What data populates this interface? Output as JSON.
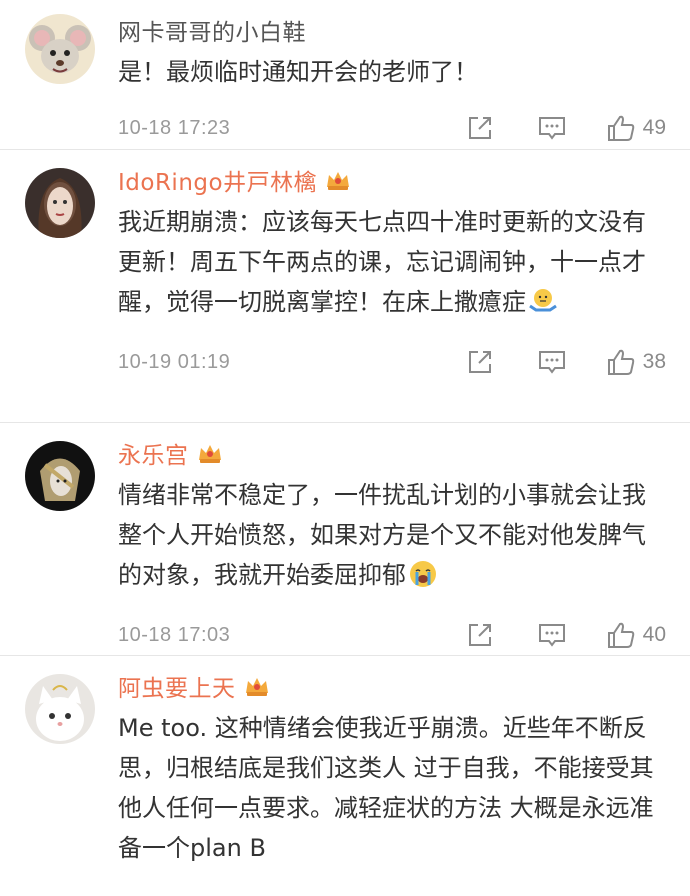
{
  "comments": [
    {
      "username": "网卡哥哥的小白鞋",
      "text": "是！最烦临时通知开会的老师了！",
      "time": "10-18 17:23",
      "likes": "49"
    },
    {
      "username": "IdoRingo井戸林檎",
      "text": "我近期崩溃：应该每天七点四十准时更新的文没有更新！周五下午两点的课，忘记调闹钟，十一点才醒，觉得一切脱离掌控！在床上撒癔症",
      "time": "10-19 01:19",
      "likes": "38"
    },
    {
      "username": "永乐宫",
      "text": "情绪非常不稳定了，一件扰乱计划的小事就会让我整个人开始愤怒，如果对方是个又不能对他发脾气的对象，我就开始委屈抑郁",
      "time": "10-18 17:03",
      "likes": "40"
    },
    {
      "username": "阿虫要上天",
      "text": "Me too. 这种情绪会使我近乎崩溃。近些年不断反思，归根结底是我们这类人 过于自我，不能接受其他人任何一点要求。减轻症状的方法 大概是永远准备一个plan B",
      "time": "",
      "likes": ""
    }
  ],
  "icons": {
    "share": "share-icon",
    "reply": "comment-icon",
    "like": "thumbs-up-icon",
    "vip": "vip-crown-icon"
  },
  "colors": {
    "vip_name": "#eb7350",
    "normal_name": "#555555",
    "meta": "#9a9a9a"
  }
}
